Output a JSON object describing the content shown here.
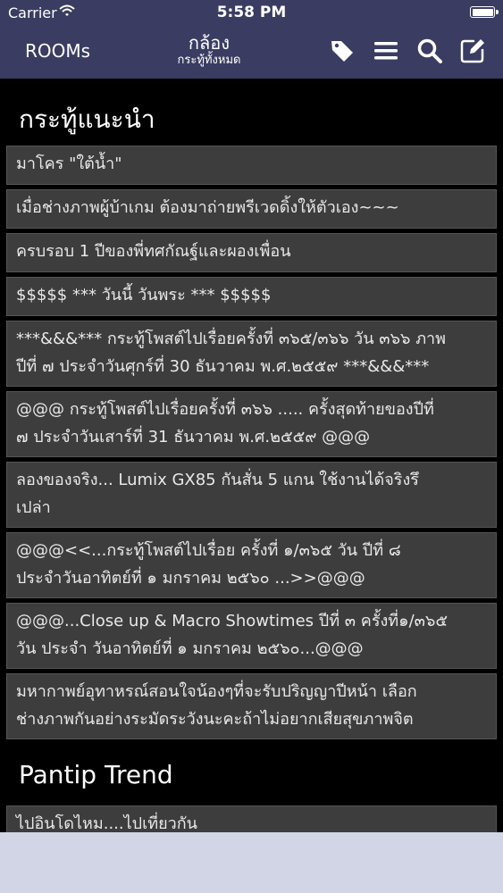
{
  "status": {
    "carrier": "Carrier",
    "time": "5:58 PM"
  },
  "nav": {
    "back_label": "ROOMs",
    "title": "กล้อง",
    "subtitle": "กระทู้ทั้งหมด",
    "icons": [
      "tag-icon",
      "menu-icon",
      "search-icon",
      "compose-icon"
    ]
  },
  "sections": [
    {
      "title": "กระทู้แนะนำ",
      "items": [
        {
          "lines": [
            "มาโคร \"ใต้น้ำ\""
          ]
        },
        {
          "lines": [
            "เมื่อช่างภาพผู้บ้าเกม ต้องมาถ่ายพรีเวดดิ้งให้ตัวเอง~~~"
          ]
        },
        {
          "lines": [
            "ครบรอบ 1 ปีของพี่ทศกัณฐ์และผองเพื่อน"
          ]
        },
        {
          "lines": [
            "$$$$$ *** วันนี้ วันพระ *** $$$$$"
          ]
        },
        {
          "lines": [
            "***&&&*** กระทู้โพสต์ไปเรื่อยครั้งที่ ๓๖๕/๓๖๖ วัน ๓๖๖ ภาพ",
            "ปีที่ ๗ ประจำวันศุกร์ที่ 30 ธันวาคม พ.ศ.๒๕๕๙ ***&&&***"
          ]
        },
        {
          "lines": [
            "@@@ กระทู้โพสต์ไปเรื่อยครั้งที่ ๓๖๖ ..... ครั้งสุดท้ายของปีที่",
            "๗ ประจำวันเสาร์ที่ 31 ธันวาคม พ.ศ.๒๕๕๙ @@@"
          ]
        },
        {
          "lines": [
            "ลองของจริง... Lumix GX85 กันสั่น 5 แกน ใช้งานได้จริงรึ",
            "เปล่า"
          ]
        },
        {
          "lines": [
            "@@@<<...กระทู้โพสต์ไปเรื่อย ครั้งที่ ๑/๓๖๕ วัน ปีที่ ๘",
            "ประจำวันอาทิตย์ที่ ๑ มกราคม ๒๕๖๐ ...>>@@@"
          ]
        },
        {
          "lines": [
            "@@@...Close up & Macro Showtimes ปีที่ ๓ ครั้งที่๑/๓๖๕",
            "วัน ประจำ วันอาทิตย์ที่ ๑ มกราคม ๒๕๖๐...@@@"
          ]
        },
        {
          "lines": [
            "มหากาพย์อุทาหรณ์สอนใจน้องๆที่จะรับปริญญาปีหน้า เลือก",
            "ช่างภาพกันอย่างระมัดระวังนะคะถ้าไม่อยากเสียสุขภาพจิต"
          ]
        }
      ]
    },
    {
      "title": "Pantip Trend",
      "items": [
        {
          "lines": [
            "ไปอินโดไหม....ไปเที่ยวกัน"
          ]
        }
      ]
    }
  ],
  "colors": {
    "navbar": "#3a3d61",
    "item_bg": "#3d3d3d",
    "tabbar": "#d1d5e5"
  }
}
